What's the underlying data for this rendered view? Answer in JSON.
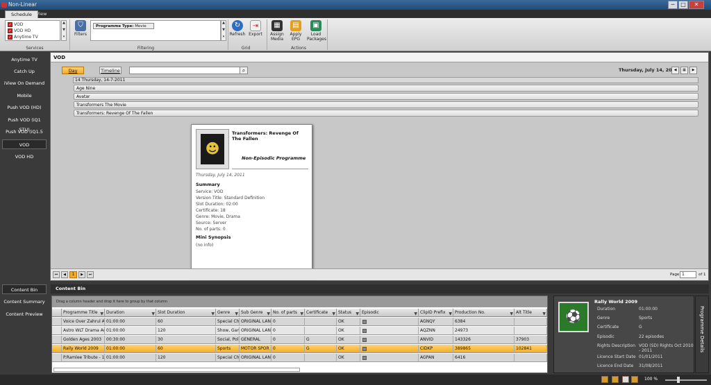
{
  "window": {
    "title": "Non-Linear",
    "min": "─",
    "max": "□",
    "close": "✕"
  },
  "tabs": [
    "Schedule",
    "View"
  ],
  "ribbon": {
    "services": {
      "items": [
        "VOD",
        "VOD HD",
        "Anytime TV"
      ],
      "label": "Services"
    },
    "filters_label": "Filters",
    "filtering": {
      "tag_key": "Programme Type:",
      "tag_value": "Movie",
      "label": "Filtering"
    },
    "grid": {
      "label": "Grid",
      "refresh": "Refresh",
      "export": "Export"
    },
    "actions": {
      "label": "Actions",
      "assign": "Assign Media",
      "apply": "Apply EPG",
      "load": "Load Packages"
    }
  },
  "sidebar": [
    "Anytime TV",
    "Catch Up",
    "iView On Demand",
    "Mobile",
    "Push VOD (HD)",
    "Push VOD (iQ1 STU)",
    "Push VOD (iQ1.5 STU)",
    "VOD",
    "VOD HD"
  ],
  "main": {
    "header": "VOD",
    "day": "Day",
    "timeline": "Timeline",
    "date": "Thursday, July 14, 2011",
    "day_label": "14 Thursday, 14-7-2011",
    "programmes": [
      "Age Nine",
      "Avatar",
      "Transformers The Movie",
      "Transformers: Revenge Of The Fallen"
    ]
  },
  "popup": {
    "title": "Transformers: Revenge Of The Fallen",
    "type": "Non-Episodic Programme",
    "date": "Thursday, July 14, 2011",
    "summary_h": "Summary",
    "lines": [
      "Service: VOD",
      "Version Title: Standard Definition",
      "Slot Duration: 02:00",
      "Certificate: 18",
      "Genre: Movie, Drama",
      "Source: Server",
      "No. of parts: 0"
    ],
    "synopsis_h": "Mini Synopsis",
    "synopsis": "(no info)"
  },
  "pager": {
    "page": "1",
    "label": "Page",
    "input": "1",
    "of": "of 1"
  },
  "bottom_sidebar": [
    "Content Bin",
    "Content Summary",
    "Content Preview"
  ],
  "content_bin": {
    "header": "Content Bin",
    "group_hint": "Drag a column header and drop it here to group by that column",
    "columns": [
      "Programme Title",
      "Duration",
      "Slot Duration",
      "Genre",
      "Sub Genre",
      "No. of parts",
      "Certificate",
      "Status",
      "Episodic",
      "ClipID Prefix",
      "Production No.",
      "Alt Title"
    ],
    "rows": [
      [
        "Voice Over Zahrul Ali",
        "01:00:00",
        "60",
        "Special Ch",
        "ORIGINAL LAN",
        "0",
        "",
        "OK",
        "",
        "AGNQY",
        "6384",
        ""
      ],
      [
        "Astro WLT Drama Aw",
        "01:00:00",
        "120",
        "Show, Gam",
        "ORIGINAL LAN",
        "0",
        "",
        "OK",
        "",
        "AQZNN",
        "24973",
        ""
      ],
      [
        "Golden Ages 2003",
        "00:30:00",
        "30",
        "Social, Poli",
        "GENERAL",
        "0",
        "G",
        "OK",
        "",
        "ANVID",
        "143326",
        "37903"
      ],
      [
        "Rally World 2009",
        "01:00:00",
        "60",
        "Sports",
        "MOTOR SPOR",
        "0",
        "G",
        "OK",
        "",
        "CIDKP",
        "389865",
        "102841"
      ],
      [
        "P.Ramlee Tribute - 19",
        "01:00:00",
        "120",
        "Special Ch",
        "ORIGINAL LAN",
        "0",
        "",
        "OK",
        "",
        "AGPAN",
        "6416",
        ""
      ]
    ]
  },
  "details": {
    "title": "Rally World 2009",
    "tab": "Programme Details",
    "fields": [
      [
        "Duration",
        "01:00:00"
      ],
      [
        "Genre",
        "Sports"
      ],
      [
        "Certificate",
        "G"
      ],
      [
        "Episodic",
        "22 episodes"
      ],
      [
        "Rights Description",
        "VOD (SD) Rights Oct 2010 - 2011"
      ],
      [
        "Licence Start Date",
        "01/01/2011"
      ],
      [
        "Licence End Date",
        "31/08/2011"
      ]
    ]
  },
  "status": {
    "zoom": "100 %"
  },
  "colors": {
    "accent": "#f4a927",
    "titlebar": "#2a5a8a"
  }
}
